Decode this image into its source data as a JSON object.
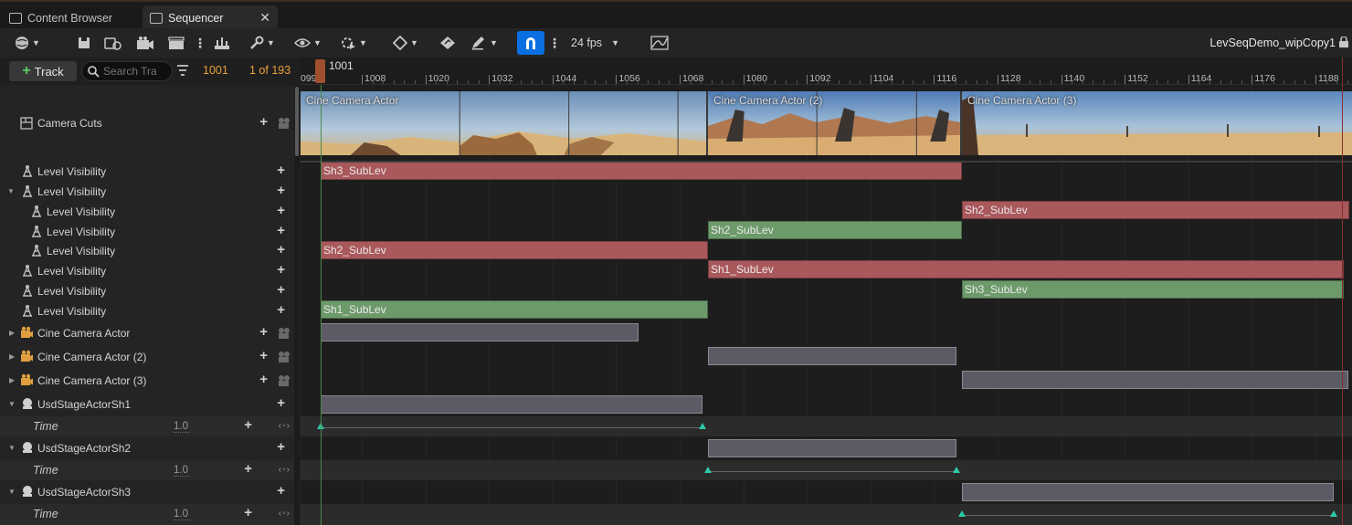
{
  "tabs": [
    {
      "label": "Content Browser",
      "active": false
    },
    {
      "label": "Sequencer",
      "active": true
    }
  ],
  "toolbar": {
    "fps": "24 fps",
    "sequence_name": "LevSeqDemo_wipCopy1",
    "snap_color": "#0a6fe0"
  },
  "controls": {
    "add_track_label": "Track",
    "search_placeholder": "Search Tra",
    "current_frame": "1001",
    "match_count": "1 of 193"
  },
  "ruler": {
    "playhead_label": "1001",
    "first_partial": "0996",
    "ticks": [
      "1008",
      "1020",
      "1032",
      "1044",
      "1056",
      "1068",
      "1080",
      "1092",
      "1104",
      "1116",
      "1128",
      "1140",
      "1152",
      "1164",
      "1176",
      "1188"
    ]
  },
  "tracks": [
    {
      "label": "Camera Cuts",
      "icon": "camera-cuts-icon"
    },
    {
      "label": "Level Visibility",
      "icon": "level-visibility-icon"
    },
    {
      "label": "Level Visibility",
      "icon": "level-visibility-icon",
      "expanded": true
    },
    {
      "label": "Level Visibility",
      "icon": "level-visibility-icon"
    },
    {
      "label": "Level Visibility",
      "icon": "level-visibility-icon"
    },
    {
      "label": "Level Visibility",
      "icon": "level-visibility-icon"
    },
    {
      "label": "Level Visibility",
      "icon": "level-visibility-icon"
    },
    {
      "label": "Level Visibility",
      "icon": "level-visibility-icon"
    },
    {
      "label": "Level Visibility",
      "icon": "level-visibility-icon"
    },
    {
      "label": "Cine Camera Actor",
      "icon": "cine-camera-icon"
    },
    {
      "label": "Cine Camera Actor (2)",
      "icon": "cine-camera-icon"
    },
    {
      "label": "Cine Camera Actor (3)",
      "icon": "cine-camera-icon"
    },
    {
      "label": "UsdStageActorSh1",
      "icon": "usd-stage-icon"
    },
    {
      "label": "Time",
      "value": "1.0"
    },
    {
      "label": "UsdStageActorSh2",
      "icon": "usd-stage-icon"
    },
    {
      "label": "Time",
      "value": "1.0"
    },
    {
      "label": "UsdStageActorSh3",
      "icon": "usd-stage-icon"
    },
    {
      "label": "Time",
      "value": "1.0"
    }
  ],
  "shots": [
    {
      "title": "Cine Camera Actor"
    },
    {
      "title": "Cine Camera Actor (2)"
    },
    {
      "title": "Cine Camera Actor (3)"
    }
  ],
  "sections": [
    {
      "label": "Sh3_SubLev",
      "color": "red"
    },
    {
      "label": "Sh2_SubLev",
      "color": "red"
    },
    {
      "label": "Sh2_SubLev",
      "color": "green"
    },
    {
      "label": "Sh2_SubLev",
      "color": "red"
    },
    {
      "label": "Sh1_SubLev",
      "color": "red"
    },
    {
      "label": "Sh3_SubLev",
      "color": "green"
    },
    {
      "label": "Sh1_SubLev",
      "color": "green"
    }
  ],
  "colors": {
    "subsection_red": "#a9585b",
    "subsection_green": "#6d9a6a",
    "keyframe": "#2ec8a8",
    "frame_counter": "#e8a23a"
  }
}
